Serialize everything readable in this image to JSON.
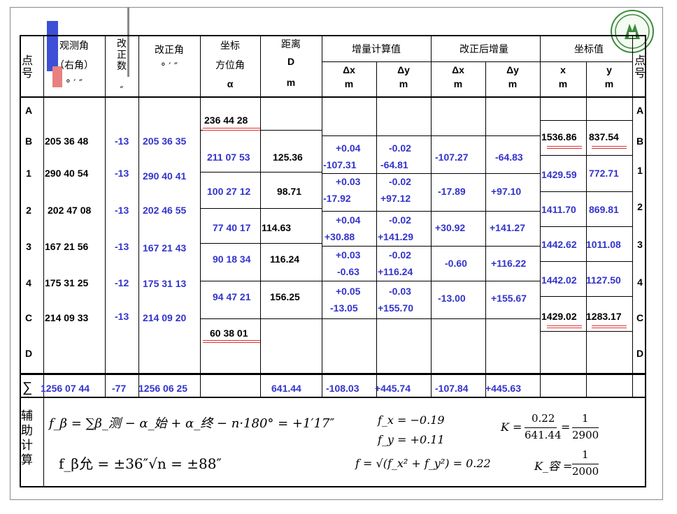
{
  "header": {
    "col_point": "点号",
    "col_obs_angle": "观测角",
    "col_obs_angle_sub": "（右角）",
    "col_obs_angle_units": "° ′ ″",
    "col_corr": "改正数",
    "col_corr_unit": "″",
    "col_corrected_angle": "改正角",
    "col_corrected_angle_units": "° ′ ″",
    "col_azimuth": "坐标",
    "col_azimuth_sub": "方位角",
    "col_azimuth_sym": "α",
    "col_dist": "距离",
    "col_dist_sym": "D",
    "col_dist_unit": "m",
    "col_increment": "增量计算值",
    "col_corrected_increment": "改正后增量",
    "col_coords": "坐标值",
    "sub_dx": "Δx",
    "sub_dy": "Δy",
    "sub_m": "m",
    "sub_x": "x",
    "sub_y": "y",
    "col_point_right": "点号"
  },
  "points": [
    "A",
    "B",
    "1",
    "2",
    "3",
    "4",
    "C",
    "D"
  ],
  "obs_angles": [
    "205 36 48",
    "290 40 54",
    "202 47 08",
    "167 21 56",
    "175 31 25",
    "214 09 33"
  ],
  "corrections": [
    "-13",
    "-13",
    "-13",
    "-13",
    "-12",
    "-13"
  ],
  "corrected_angles": [
    "205 36 35",
    "290 40 41",
    "202 46 55",
    "167 21 43",
    "175 31 13",
    "214 09 20"
  ],
  "azimuths": [
    "236 44 28",
    "211 07 53",
    "100 27 12",
    "77 40 17",
    "90 18 34",
    "94 47 21",
    "60 38 01"
  ],
  "distances": [
    "125.36",
    "98.71",
    "114.63",
    "116.24",
    "156.25"
  ],
  "inc_dx_corr": [
    "+0.04",
    "+0.03",
    "+0.04",
    "+0.03",
    "+0.05"
  ],
  "inc_dx": [
    "-107.31",
    "-17.92",
    "+30.88",
    "-0.63",
    "-13.05"
  ],
  "inc_dy_corr": [
    "-0.02",
    "-0.02",
    "-0.02",
    "-0.02",
    "-0.03"
  ],
  "inc_dy": [
    "-64.81",
    "+97.12",
    "+141.29",
    "+116.24",
    "+155.70"
  ],
  "corr_dx": [
    "-107.27",
    "-17.89",
    "+30.92",
    "-0.60",
    "-13.00"
  ],
  "corr_dy": [
    "-64.83",
    "+97.10",
    "+141.27",
    "+116.22",
    "+155.67"
  ],
  "coord_x": [
    "1536.86",
    "1429.59",
    "1411.70",
    "1442.62",
    "1442.02",
    "1429.02"
  ],
  "coord_y": [
    "837.54",
    "772.71",
    "869.81",
    "1011.08",
    "1127.50",
    "1283.17"
  ],
  "totals": {
    "symbol": "∑",
    "obs_angle": "1256 07 44",
    "corr": "-77",
    "corrected_angle": "1256 06 25",
    "distance": "641.44",
    "dx": "-108.03",
    "dy": "+445.74",
    "corr_dx": "-107.84",
    "corr_dy": "+445.63"
  },
  "aux": {
    "label": "辅助计算",
    "f_beta": "f_β = ∑β_测 − α_始 + α_终 − n·180° = +1′17″",
    "f_beta_allow": "f_β允 = ±36″√n = ±88″",
    "f_x": "f_x = −0.19",
    "f_y": "f_y = +0.11",
    "f": "f = √(f_x² + f_y²) = 0.22",
    "K_lhs": "K =",
    "K_num": "0.22",
    "K_den": "641.44",
    "K_num2": "1",
    "K_den2": "2900",
    "K_allow_lhs": "K_容 =",
    "K_allow_num": "1",
    "K_allow_den": "2000"
  },
  "colors": {
    "blue_text": "#3333cc",
    "underline_red": "#e03030",
    "grid": "#000000"
  }
}
